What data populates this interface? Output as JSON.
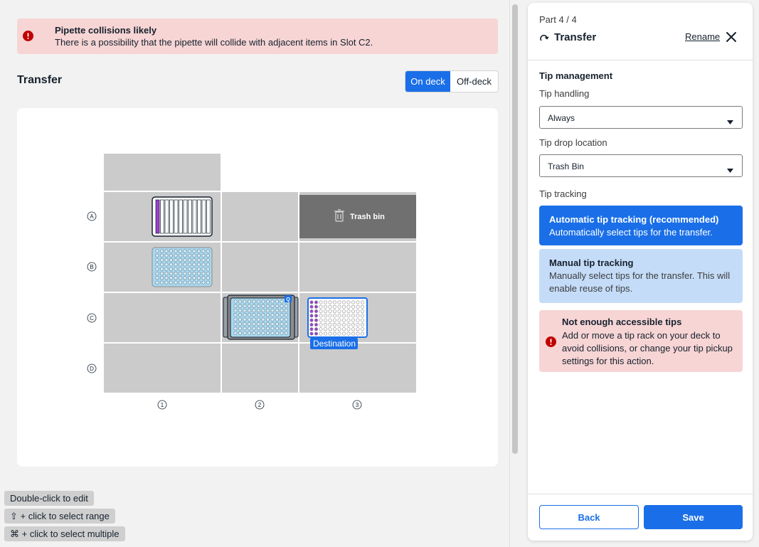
{
  "alert": {
    "title": "Pipette collisions likely",
    "body": "There is a possibility that the pipette will collide with adjacent items in Slot C2.",
    "icon": "error-icon"
  },
  "main": {
    "title": "Transfer",
    "view_toggle": {
      "on_deck": "On deck",
      "off_deck": "Off-deck",
      "selected": "On deck"
    }
  },
  "deck": {
    "rows": [
      "A",
      "B",
      "C",
      "D"
    ],
    "columns": [
      "1",
      "2",
      "3"
    ],
    "trash_label": "Trash bin",
    "destination_label": "Destination",
    "adapter_badge": "Q"
  },
  "hints": [
    "Double-click to edit",
    "⇧ + click to select range",
    "⌘ + click to select multiple"
  ],
  "panel": {
    "part": "Part 4 / 4",
    "title": "Transfer",
    "rename": "Rename",
    "section_title": "Tip management",
    "tip_handling": {
      "label": "Tip handling",
      "value": "Always"
    },
    "tip_drop": {
      "label": "Tip drop location",
      "value": "Trash Bin"
    },
    "tip_tracking_label": "Tip tracking",
    "options": [
      {
        "title": "Automatic tip tracking (recommended)",
        "body": "Automatically select tips for the transfer.",
        "selected": true
      },
      {
        "title": "Manual tip tracking",
        "body": "Manually select tips for the transfer. This will enable reuse of tips.",
        "selected": false
      }
    ],
    "warning": {
      "title": "Not enough accessible tips",
      "body": "Add or move a tip rack on your deck to avoid collisions, or change your tip pickup settings for this action."
    },
    "back": "Back",
    "save": "Save"
  },
  "colors": {
    "accent": "#1a6fe8",
    "error_bg": "#f7d5d5",
    "error_icon": "#bf0000",
    "slot": "#cbcbcb",
    "trash": "#707070",
    "labware_blue": "#a8d8ef",
    "purple": "#9b3fcf"
  }
}
